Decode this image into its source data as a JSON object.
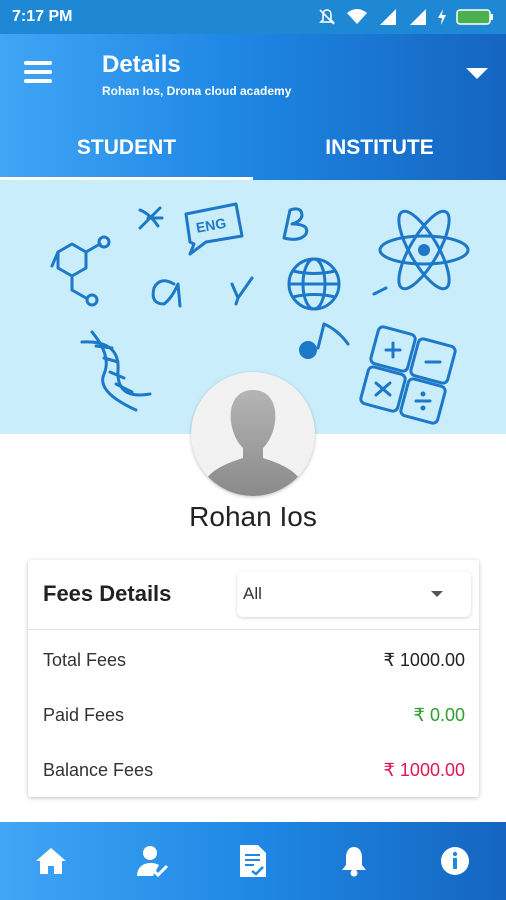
{
  "status_bar": {
    "time": "7:17 PM"
  },
  "header": {
    "title": "Details",
    "subtitle": "Rohan Ios, Drona cloud academy"
  },
  "tabs": [
    {
      "label": "STUDENT",
      "active": true
    },
    {
      "label": "INSTITUTE",
      "active": false
    }
  ],
  "banner": {
    "text_ENG": "ENG"
  },
  "profile": {
    "name": "Rohan Ios"
  },
  "fees": {
    "title": "Fees Details",
    "filter_value": "All",
    "rows": [
      {
        "label": "Total Fees",
        "value": "₹ 1000.00",
        "color": "#222222"
      },
      {
        "label": "Paid Fees",
        "value": "₹ 0.00",
        "color": "#2e9d2e"
      },
      {
        "label": "Balance Fees",
        "value": "₹ 1000.00",
        "color": "#e0174f"
      }
    ]
  },
  "bottom_nav": [
    "home-icon",
    "profile-check-icon",
    "document-icon",
    "bell-icon",
    "info-icon"
  ],
  "colors": {
    "primary": "#1e88e5",
    "banner_bg": "#c9edfb",
    "icon_blue": "#1e78c8"
  }
}
